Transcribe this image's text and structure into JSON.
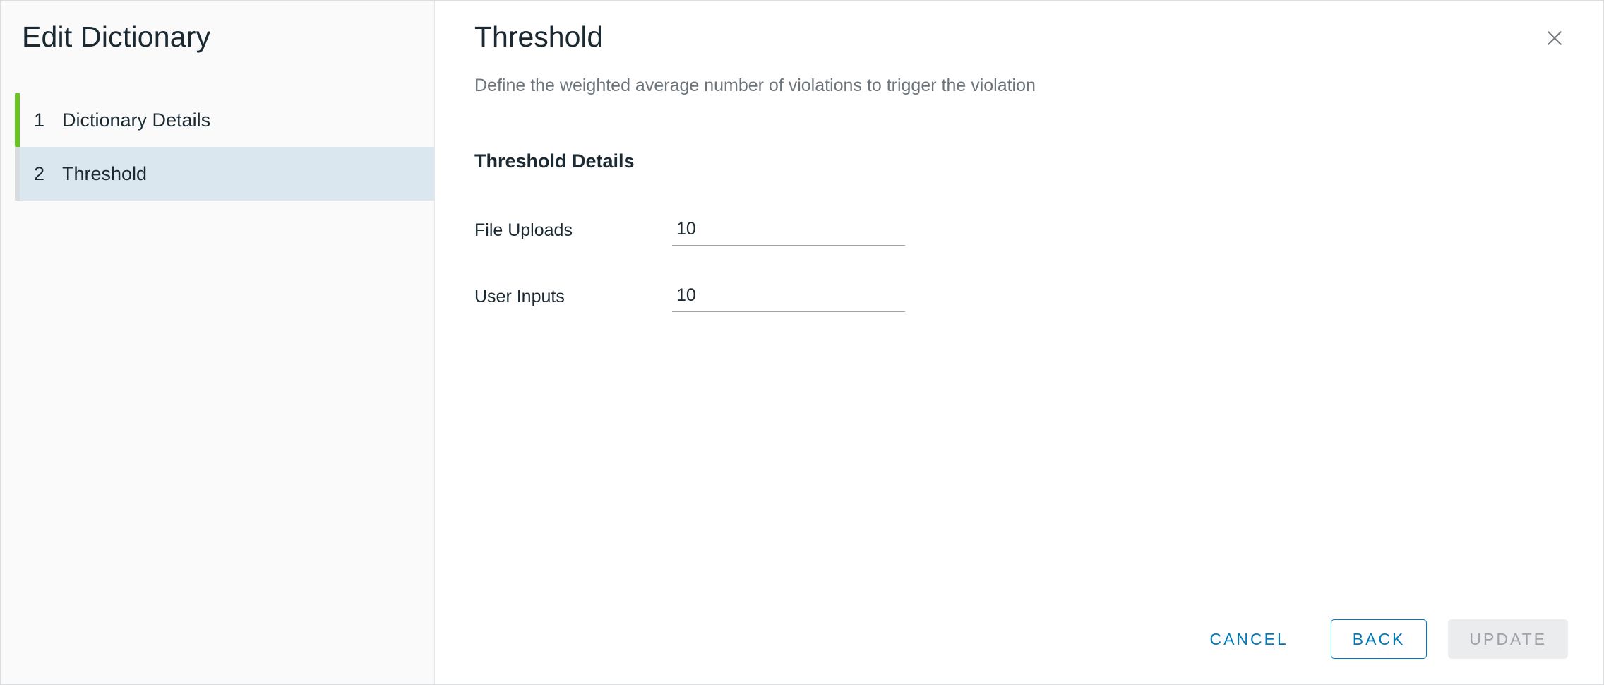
{
  "sidebar": {
    "title": "Edit Dictionary",
    "steps": [
      {
        "num": "1",
        "label": "Dictionary Details",
        "state": "completed"
      },
      {
        "num": "2",
        "label": "Threshold",
        "state": "current"
      }
    ]
  },
  "content": {
    "title": "Threshold",
    "subtext": "Define the weighted average number of violations to trigger the violation",
    "section_label": "Threshold Details",
    "fields": {
      "file_uploads": {
        "label": "File Uploads",
        "value": "10"
      },
      "user_inputs": {
        "label": "User Inputs",
        "value": "10"
      }
    }
  },
  "footer": {
    "cancel": "CANCEL",
    "back": "BACK",
    "update": "UPDATE"
  }
}
